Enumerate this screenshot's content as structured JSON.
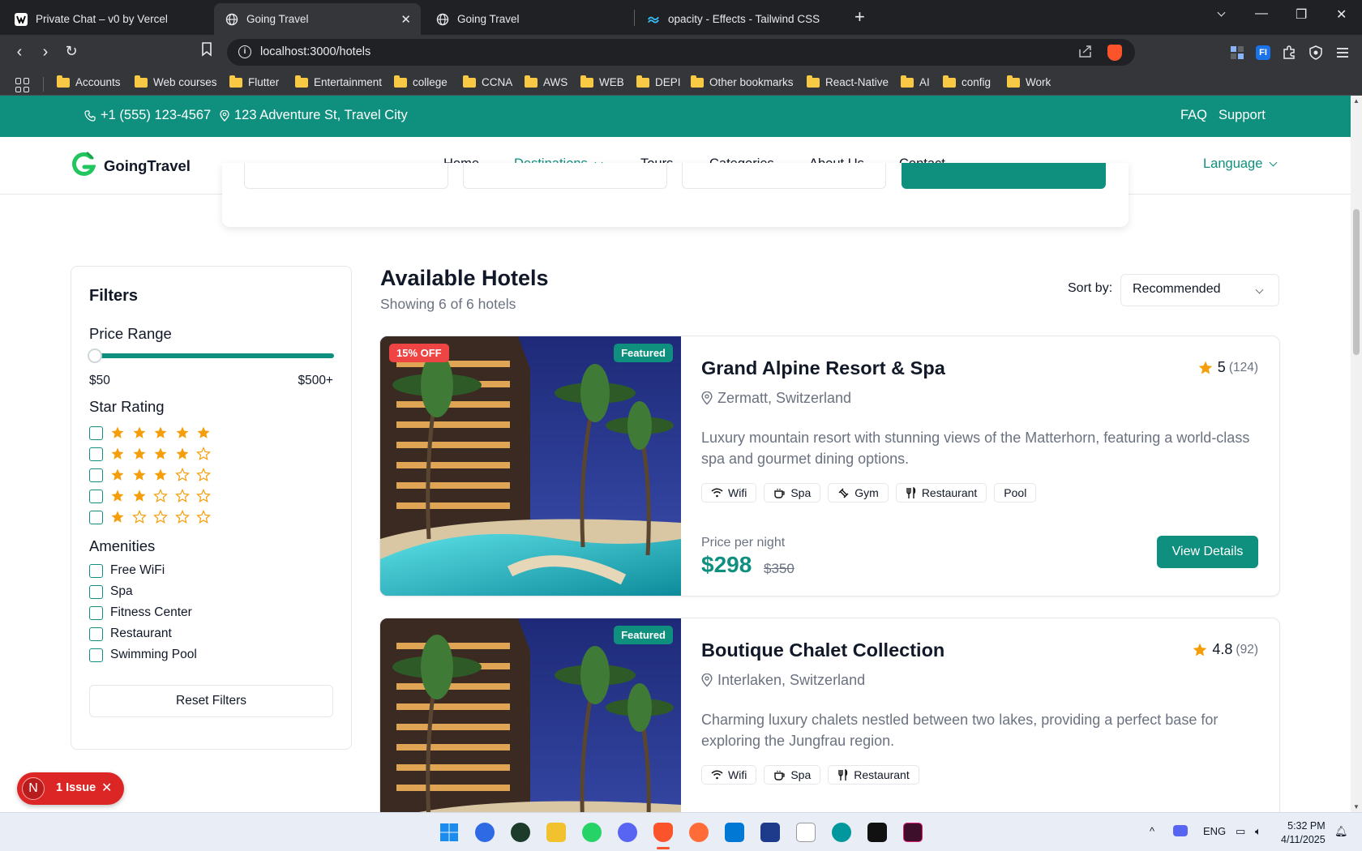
{
  "browser": {
    "tabs": [
      {
        "title": "Private Chat – v0 by Vercel",
        "active": false
      },
      {
        "title": "Going Travel",
        "active": true
      },
      {
        "title": "Going Travel",
        "active": false
      },
      {
        "title": "opacity - Effects - Tailwind CSS",
        "active": false
      }
    ],
    "url": "localhost:3000/hotels",
    "bookmarks": [
      "Accounts",
      "Web courses",
      "Flutter",
      "Entertainment",
      "college",
      "CCNA",
      "AWS",
      "WEB",
      "DEPI",
      "Other bookmarks",
      "React-Native",
      "AI",
      "config",
      "Work"
    ]
  },
  "topbar": {
    "phone": "+1 (555) 123-4567",
    "address": "123 Adventure St, Travel City",
    "faq": "FAQ",
    "support": "Support"
  },
  "nav": {
    "brand": "GoingTravel",
    "links": [
      "Home",
      "Destinations",
      "Tours",
      "Categories",
      "About Us",
      "Contact"
    ],
    "active": "Destinations",
    "language": "Language"
  },
  "filters": {
    "title": "Filters",
    "price_heading": "Price Range",
    "price_min": "$50",
    "price_max": "$500+",
    "rating_heading": "Star Rating",
    "ratings": [
      5,
      4,
      3,
      2,
      1
    ],
    "amenities_heading": "Amenities",
    "amenities": [
      "Free WiFi",
      "Spa",
      "Fitness Center",
      "Restaurant",
      "Swimming Pool"
    ],
    "reset": "Reset Filters"
  },
  "results": {
    "title": "Available Hotels",
    "subtitle": "Showing 6 of 6 hotels",
    "sort_label": "Sort by:",
    "sort_value": "Recommended"
  },
  "hotels": [
    {
      "name": "Grand Alpine Resort & Spa",
      "location": "Zermatt, Switzerland",
      "rating": "5",
      "reviews": "(124)",
      "description": "Luxury mountain resort with stunning views of the Matterhorn, featuring a world-class spa and gourmet dining options.",
      "amenities": [
        "Wifi",
        "Spa",
        "Gym",
        "Restaurant",
        "Pool"
      ],
      "discount": "15% OFF",
      "featured": "Featured",
      "price_label": "Price per night",
      "price": "$298",
      "old_price": "$350",
      "cta": "View Details"
    },
    {
      "name": "Boutique Chalet Collection",
      "location": "Interlaken, Switzerland",
      "rating": "4.8",
      "reviews": "(92)",
      "description": "Charming luxury chalets nestled between two lakes, providing a perfect base for exploring the Jungfrau region.",
      "amenities": [
        "Wifi",
        "Spa",
        "Restaurant"
      ],
      "featured": "Featured"
    }
  ],
  "issue": {
    "initial": "N",
    "label": "1 Issue"
  },
  "taskbar": {
    "lang": "ENG",
    "time": "5:32 PM",
    "date": "4/11/2025"
  },
  "colors": {
    "brand": "#0f8f7d",
    "star": "#f59e0b",
    "discount": "#ef4444"
  }
}
